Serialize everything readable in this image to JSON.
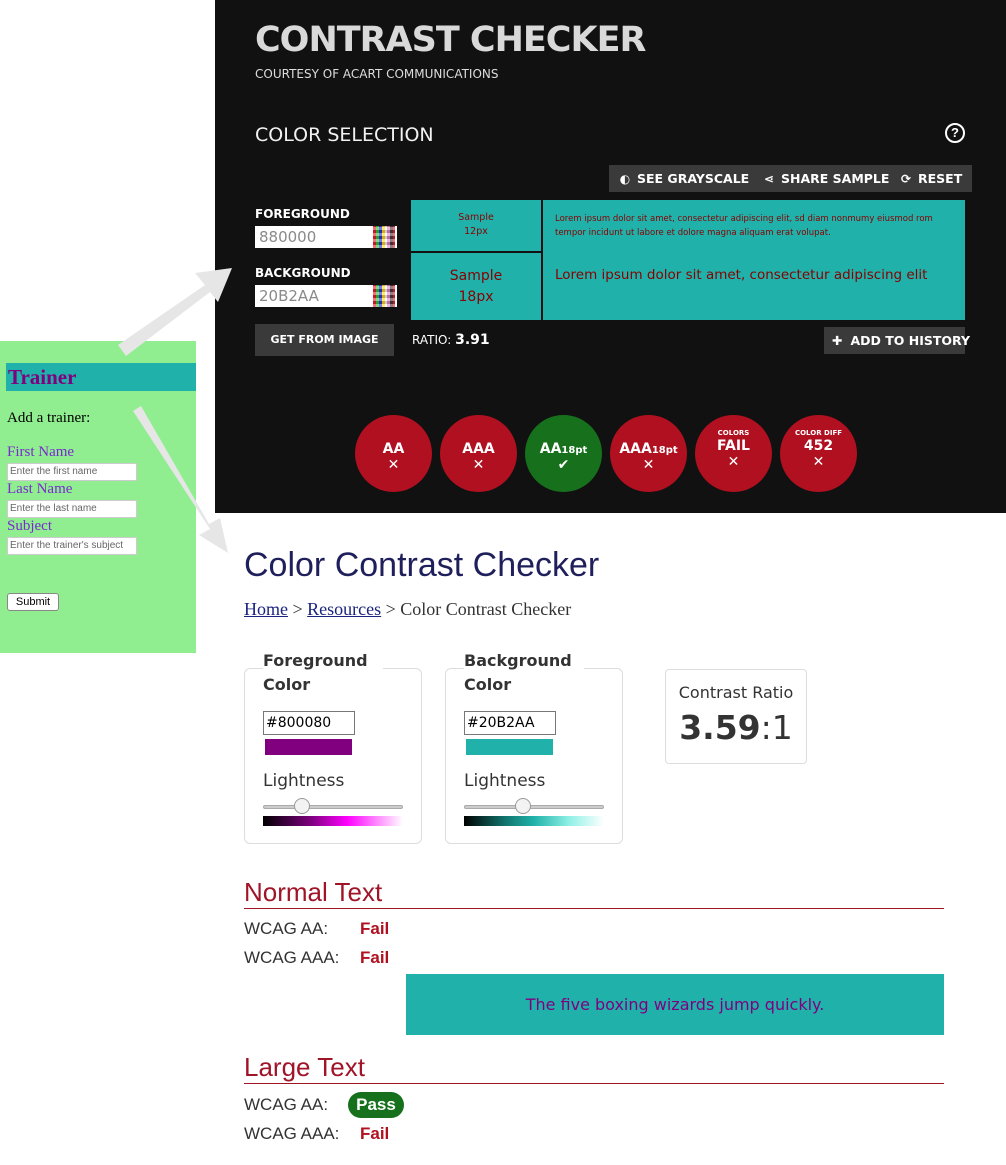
{
  "contrast_checker": {
    "title": "CONTRAST CHECKER",
    "subtitle": "COURTESY OF ACART COMMUNICATIONS",
    "section_title": "COLOR SELECTION",
    "help_label": "?",
    "buttons": {
      "grayscale": "SEE GRAYSCALE",
      "share": "SHARE SAMPLE",
      "reset": "RESET",
      "get_from_image": "GET FROM IMAGE",
      "add_history": "ADD TO HISTORY"
    },
    "foreground_label": "FOREGROUND",
    "foreground_value": "880000",
    "background_label": "BACKGROUND",
    "background_value": "20B2AA",
    "sample_small_title": "Sample",
    "sample_small_size": "12px",
    "sample_large_title": "Sample",
    "sample_large_size": "18px",
    "lorem_small": "Lorem ipsum dolor sit amet, consectetur adipiscing elit, sd diam nonmumy eiusmod rom tempor incidunt ut labore et dolore magna aliquam erat volupat.",
    "lorem_large": "Lorem ipsum dolor sit amet, consectetur adipiscing elit",
    "ratio_label": "RATIO:",
    "ratio_value": "3.91",
    "results": [
      {
        "label": "AA",
        "mark": "✕",
        "status": "fail"
      },
      {
        "label": "AAA",
        "mark": "✕",
        "status": "fail"
      },
      {
        "label": "AA",
        "sub": "18pt",
        "mark": "✔",
        "status": "pass"
      },
      {
        "label": "AAA",
        "sub": "18pt",
        "mark": "✕",
        "status": "fail"
      },
      {
        "top": "COLORS",
        "label": "FAIL",
        "mark": "✕",
        "status": "fail"
      },
      {
        "top": "COLOR DIFF",
        "label": "452",
        "mark": "✕",
        "status": "fail"
      }
    ]
  },
  "trainer": {
    "heading": "Trainer",
    "add_text": "Add a trainer:",
    "first_name_label": "First Name",
    "first_name_placeholder": "Enter the first name",
    "last_name_label": "Last Name",
    "last_name_placeholder": "Enter the last name",
    "subject_label": "Subject",
    "subject_placeholder": "Enter the trainer's subject",
    "submit_label": "Submit"
  },
  "color_contrast": {
    "title": "Color Contrast Checker",
    "breadcrumb": {
      "home": "Home",
      "sep1": " > ",
      "resources": "Resources",
      "sep2": " > ",
      "current": "Color Contrast Checker"
    },
    "foreground": {
      "title": "Foreground Color",
      "hex": "#800080",
      "lightness_label": "Lightness",
      "swatch_color": "#800080"
    },
    "background": {
      "title": "Background Color",
      "hex": "#20B2AA",
      "lightness_label": "Lightness",
      "swatch_color": "#20B2AA"
    },
    "ratio_label": "Contrast Ratio",
    "ratio_value": "3.59",
    "ratio_suffix": ":1",
    "normal_text": {
      "heading": "Normal Text",
      "aa_label": "WCAG AA:",
      "aa_result": "Fail",
      "aaa_label": "WCAG AAA:",
      "aaa_result": "Fail"
    },
    "demo_text": "The five boxing wizards jump quickly.",
    "large_text": {
      "heading": "Large Text",
      "aa_label": "WCAG AA:",
      "aa_result": "Pass",
      "aaa_label": "WCAG AAA:",
      "aaa_result": "Fail"
    }
  },
  "colors": {
    "dark_bg": "#111111",
    "sample_bg": "#20B2AA",
    "sample_fg": "#880000",
    "fail_red": "#b01020",
    "pass_green": "#16701c",
    "trainer_bg": "#90EE90"
  }
}
